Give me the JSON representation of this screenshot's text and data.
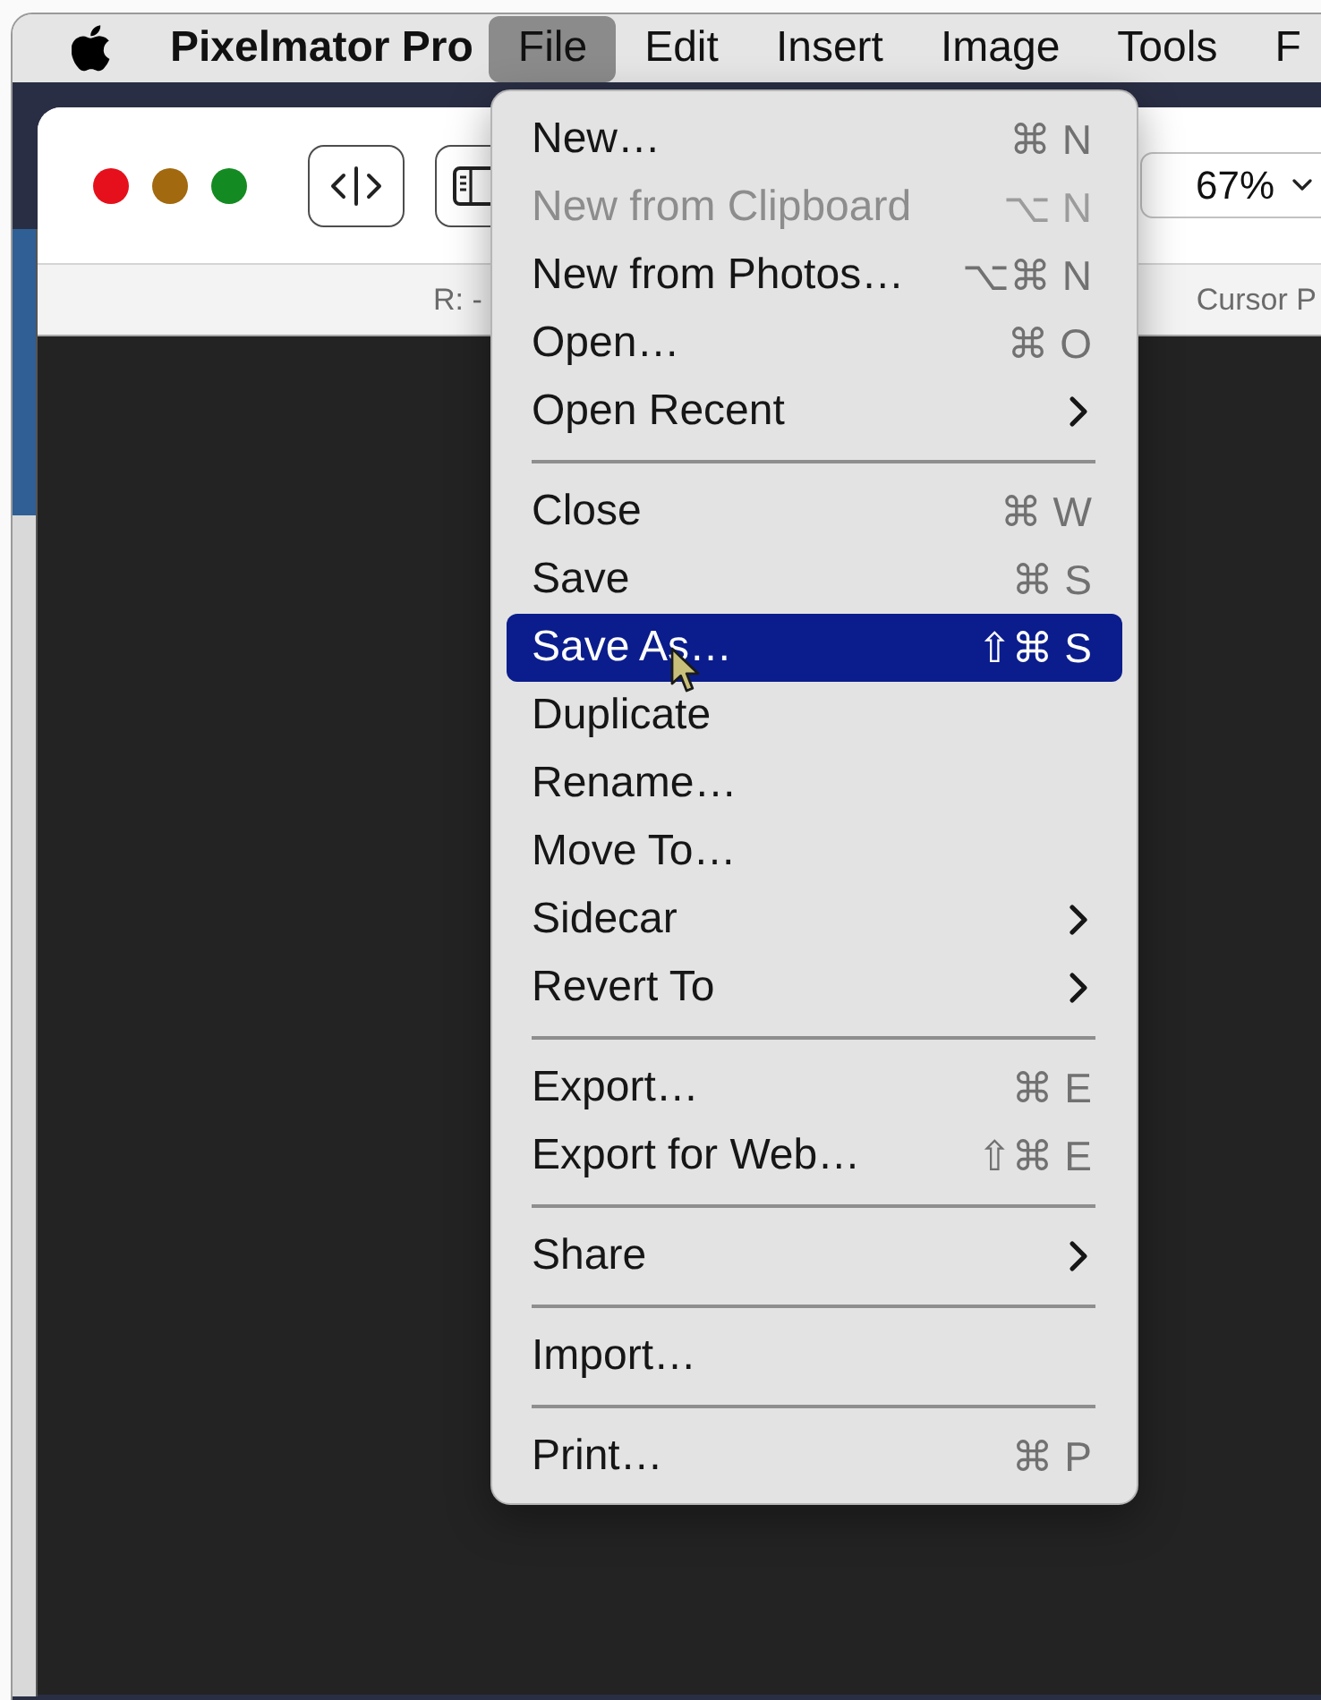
{
  "menu_bar": {
    "app_name": "Pixelmator Pro",
    "menus": [
      {
        "label": "File",
        "selected": true
      },
      {
        "label": "Edit",
        "selected": false
      },
      {
        "label": "Insert",
        "selected": false
      },
      {
        "label": "Image",
        "selected": false
      },
      {
        "label": "Tools",
        "selected": false
      },
      {
        "label": "F",
        "selected": false
      }
    ]
  },
  "window": {
    "zoom": "67%",
    "info_bar": {
      "color_readout": "R: -",
      "cursor_label": "Cursor P"
    }
  },
  "file_menu": {
    "items": [
      {
        "kind": "item",
        "label": "New…",
        "shortcut": "⌘ N",
        "disabled": false,
        "selected": false
      },
      {
        "kind": "item",
        "label": "New from Clipboard",
        "shortcut": "⌥ N",
        "disabled": true,
        "selected": false
      },
      {
        "kind": "item",
        "label": "New from Photos…",
        "shortcut": "⌥⌘ N",
        "disabled": false,
        "selected": false
      },
      {
        "kind": "item",
        "label": "Open…",
        "shortcut": "⌘ O",
        "disabled": false,
        "selected": false
      },
      {
        "kind": "submenu",
        "label": "Open Recent",
        "disabled": false,
        "selected": false
      },
      {
        "kind": "separator"
      },
      {
        "kind": "item",
        "label": "Close",
        "shortcut": "⌘ W",
        "disabled": false,
        "selected": false
      },
      {
        "kind": "item",
        "label": "Save",
        "shortcut": "⌘ S",
        "disabled": false,
        "selected": false
      },
      {
        "kind": "item",
        "label": "Save As…",
        "shortcut": "⇧⌘ S",
        "disabled": false,
        "selected": true
      },
      {
        "kind": "item",
        "label": "Duplicate",
        "disabled": false,
        "selected": false
      },
      {
        "kind": "item",
        "label": "Rename…",
        "disabled": false,
        "selected": false
      },
      {
        "kind": "item",
        "label": "Move To…",
        "disabled": false,
        "selected": false
      },
      {
        "kind": "submenu",
        "label": "Sidecar",
        "disabled": false,
        "selected": false
      },
      {
        "kind": "submenu",
        "label": "Revert To",
        "disabled": false,
        "selected": false
      },
      {
        "kind": "separator"
      },
      {
        "kind": "item",
        "label": "Export…",
        "shortcut": "⌘ E",
        "disabled": false,
        "selected": false
      },
      {
        "kind": "item",
        "label": "Export for Web…",
        "shortcut": "⇧⌘ E",
        "disabled": false,
        "selected": false
      },
      {
        "kind": "separator"
      },
      {
        "kind": "submenu",
        "label": "Share",
        "disabled": false,
        "selected": false
      },
      {
        "kind": "separator"
      },
      {
        "kind": "item",
        "label": "Import…",
        "disabled": false,
        "selected": false
      },
      {
        "kind": "separator"
      },
      {
        "kind": "item",
        "label": "Print…",
        "shortcut": "⌘ P",
        "disabled": false,
        "selected": false
      }
    ]
  }
}
